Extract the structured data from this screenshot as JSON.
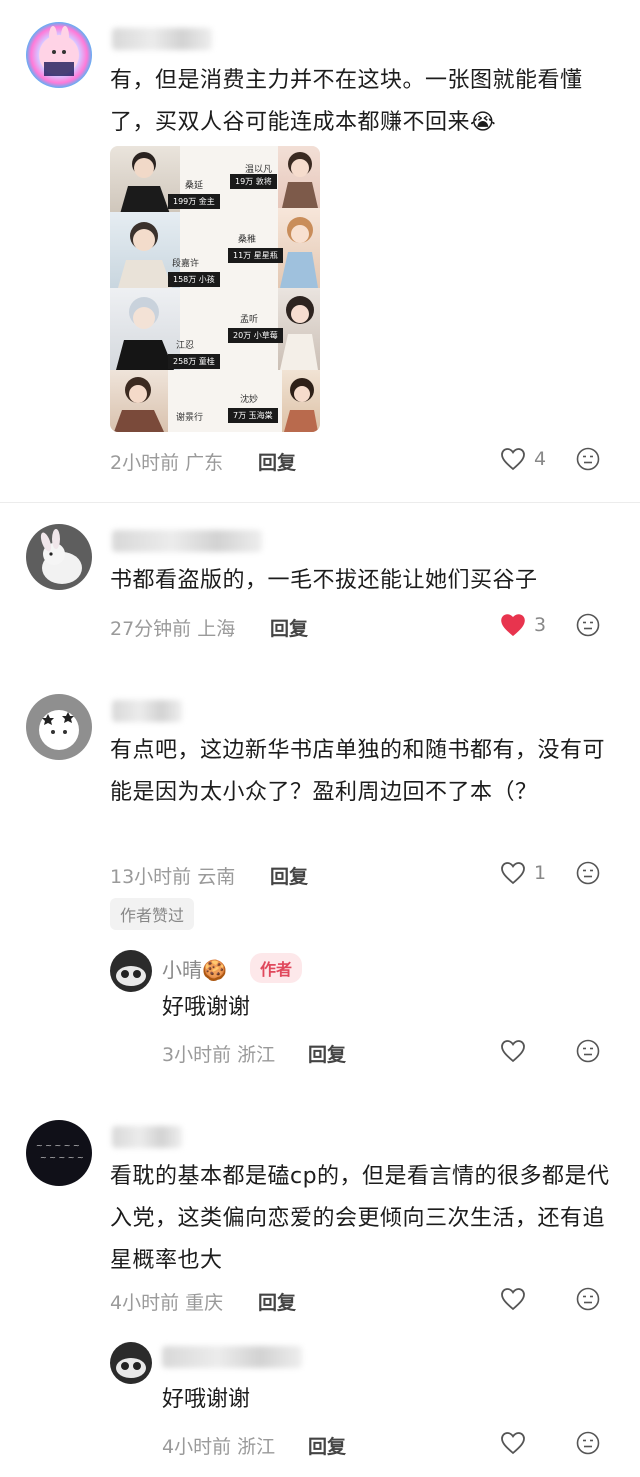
{
  "comments": [
    {
      "text": "有，但是消费主力并不在这块。一张图就能看懂了，买双人谷可能连成本都赚不回来",
      "emoji": "😭",
      "time": "2小时前",
      "location": "广东",
      "reply_label": "回复",
      "likes": "4"
    },
    {
      "text": "书都看盗版的，一毛不拔还能让她们买谷子",
      "time": "27分钟前",
      "location": "上海",
      "reply_label": "回复",
      "likes": "3",
      "liked": true
    },
    {
      "text": "有点吧，这边新华书店单独的和随书都有，没有可能是因为太小众了？盈利周边回不了本（？",
      "time": "13小时前",
      "location": "云南",
      "reply_label": "回复",
      "likes": "1",
      "badge": "作者赞过",
      "reply": {
        "username": "小晴🍪",
        "author_tag": "作者",
        "text": "好哦谢谢",
        "time": "3小时前",
        "location": "浙江",
        "reply_label": "回复"
      }
    },
    {
      "text": "看耽的基本都是磕cp的，但是看言情的很多都是代入党，这类偏向恋爱的会更倾向三次生活，还有追星概率也大",
      "time": "4小时前",
      "location": "重庆",
      "reply_label": "回复",
      "reply": {
        "text": "好哦谢谢",
        "time": "4小时前",
        "location": "浙江",
        "reply_label": "回复"
      }
    }
  ],
  "poster": {
    "characters": [
      {
        "name": "桑延",
        "fans": "199万 金主"
      },
      {
        "name": "温以凡",
        "fans": "19万 敦将"
      },
      {
        "name": "段嘉许",
        "fans": "158万 小孩"
      },
      {
        "name": "桑稚",
        "fans": "11万 星星瓶"
      },
      {
        "name": "江忍",
        "fans": "258万 童桂"
      },
      {
        "name": "孟听",
        "fans": "20万 小草莓"
      },
      {
        "name": "谢景行",
        "fans": ""
      },
      {
        "name": "沈妙",
        "fans": "7万 玉海棠"
      }
    ]
  },
  "colors": {
    "heart_active": "#e8344e",
    "author_tag_bg": "#fde8ea",
    "author_tag_text": "#e0485c"
  }
}
